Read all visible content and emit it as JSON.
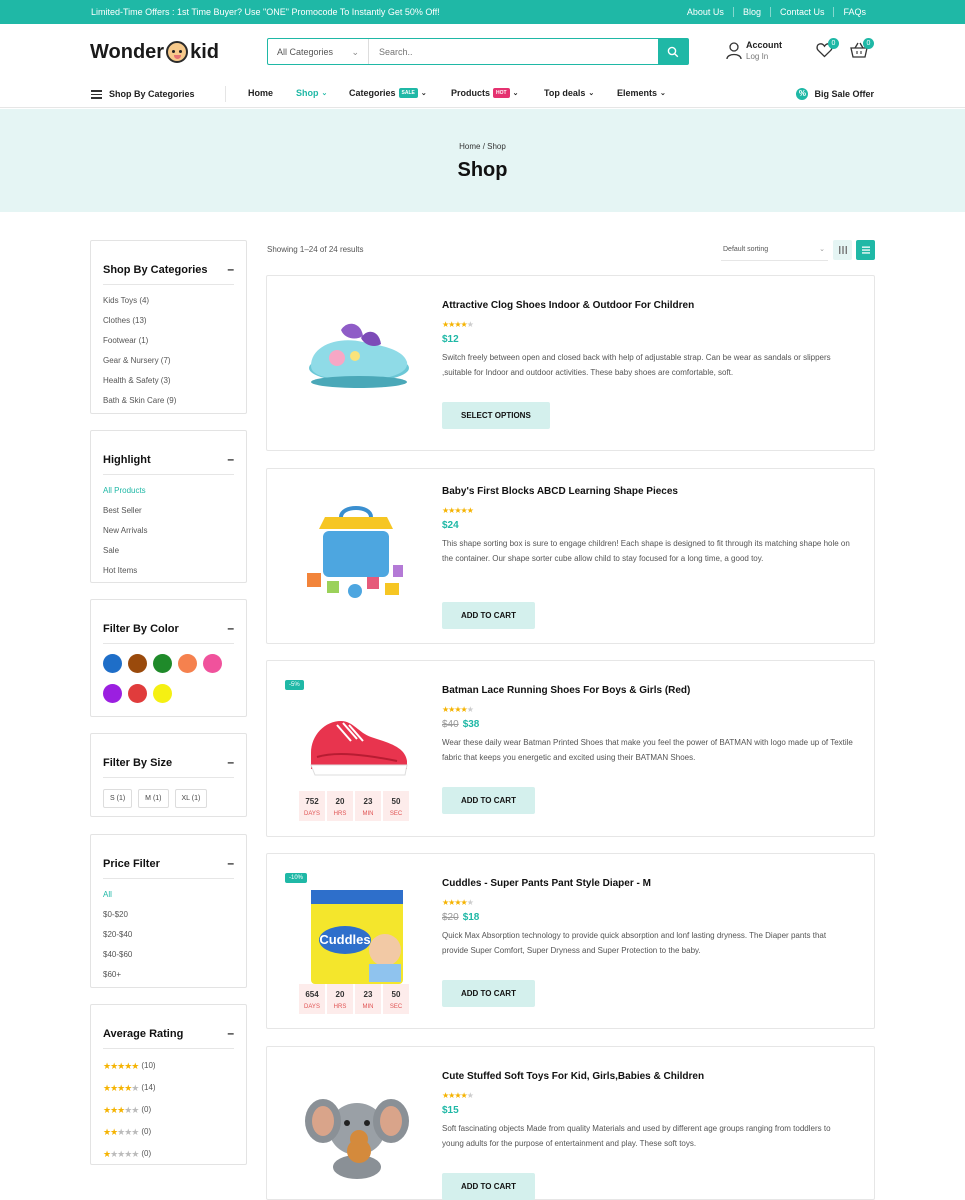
{
  "topbar": {
    "promo": "Limited-Time Offers : 1st Time Buyer? Use \"ONE\" Promocode To Instantly Get 50% Off!",
    "links": [
      "About Us",
      "Blog",
      "Contact Us",
      "FAQs"
    ]
  },
  "header": {
    "logo_left": "Wonder",
    "logo_right": "kid",
    "search_category": "All Categories",
    "search_placeholder": "Search..",
    "account_title": "Account",
    "account_sub": "Log In",
    "wishlist_count": "0",
    "cart_count": "0"
  },
  "nav": {
    "shop_by": "Shop By Categories",
    "items": [
      "Home",
      "Shop",
      "Categories",
      "Products",
      "Top deals",
      "Elements"
    ],
    "categories_tag": "SALE",
    "products_tag": "HOT",
    "big_sale": "Big Sale Offer",
    "colors": {
      "accent": "#1fb8a6",
      "sale_tag": "#1fb8a6",
      "hot_tag": "#e53270"
    }
  },
  "banner": {
    "breadcrumb": "Home / Shop",
    "title": "Shop"
  },
  "sidebar": {
    "categories": {
      "title": "Shop By Categories",
      "items": [
        "Kids Toys (4)",
        "Clothes (13)",
        "Footwear (1)",
        "Gear & Nursery (7)",
        "Health & Safety (3)",
        "Bath & Skin Care (9)"
      ]
    },
    "highlight": {
      "title": "Highlight",
      "items": [
        "All Products",
        "Best Seller",
        "New Arrivals",
        "Sale",
        "Hot Items"
      ]
    },
    "color": {
      "title": "Filter By Color",
      "swatches": [
        "#1e6ec8",
        "#9a4a0c",
        "#1f8a2a",
        "#f5814e",
        "#f0529c",
        "#9b1fe0",
        "#e03c3c",
        "#f5f012"
      ]
    },
    "size": {
      "title": "Filter By Size",
      "items": [
        "S (1)",
        "M (1)",
        "XL (1)"
      ]
    },
    "price": {
      "title": "Price Filter",
      "items": [
        "All",
        "$0-$20",
        "$20-$40",
        "$40-$60",
        "$60+"
      ]
    },
    "rating": {
      "title": "Average Rating",
      "items": [
        {
          "stars": 5,
          "count": "(10)"
        },
        {
          "stars": 4,
          "count": "(14)"
        },
        {
          "stars": 3,
          "count": "(0)"
        },
        {
          "stars": 2,
          "count": "(0)"
        },
        {
          "stars": 1,
          "count": "(0)"
        }
      ]
    }
  },
  "toolbar": {
    "results": "Showing 1–24 of 24 results",
    "sort": "Default sorting"
  },
  "products": [
    {
      "name": "Attractive Clog Shoes Indoor & Outdoor For Children",
      "rating": 4,
      "old_price": "",
      "price": "$12",
      "desc": "Switch freely between open and closed back with help of adjustable strap. Can be wear as sandals or slippers ,suitable for Indoor and outdoor activities. These baby shoes are comfortable, soft.",
      "button": "SELECT OPTIONS",
      "discount": "",
      "image": "clog-shoes"
    },
    {
      "name": "Baby's First Blocks ABCD Learning Shape Pieces",
      "rating": 5,
      "old_price": "",
      "price": "$24",
      "desc": "This shape sorting box is sure to engage children! Each shape is designed to fit through its matching shape hole on the container. Our shape sorter cube allow child to stay focused for a long time, a good toy.",
      "button": "ADD TO CART",
      "discount": "",
      "image": "shape-sorter"
    },
    {
      "name": "Batman Lace Running Shoes For Boys & Girls (Red)",
      "rating": 4,
      "old_price": "$40",
      "price": "$38",
      "desc": "Wear these daily wear Batman Printed Shoes that make you feel the power of BATMAN with logo made up of Textile fabric that keeps you energetic and excited using their BATMAN Shoes.",
      "button": "ADD TO CART",
      "discount": "-5%",
      "image": "red-sneaker",
      "countdown": [
        {
          "n": "752",
          "l": "DAYS"
        },
        {
          "n": "20",
          "l": "HRS"
        },
        {
          "n": "23",
          "l": "MIN"
        },
        {
          "n": "50",
          "l": "SEC"
        }
      ]
    },
    {
      "name": "Cuddles - Super Pants Pant Style Diaper - M",
      "rating": 4,
      "old_price": "$20",
      "price": "$18",
      "desc": "Quick Max Absorption technology to provide quick absorption and lonf lasting dryness. The Diaper pants that provide Super Comfort, Super Dryness and Super Protection to the baby.",
      "button": "ADD TO CART",
      "discount": "-10%",
      "image": "diaper-pack",
      "countdown": [
        {
          "n": "654",
          "l": "DAYS"
        },
        {
          "n": "20",
          "l": "HRS"
        },
        {
          "n": "23",
          "l": "MIN"
        },
        {
          "n": "50",
          "l": "SEC"
        }
      ]
    },
    {
      "name": "Cute Stuffed Soft Toys For Kid, Girls,Babies & Children",
      "rating": 4,
      "old_price": "",
      "price": "$15",
      "desc": "Soft fascinating objects Made from quality Materials and used by different age groups ranging from toddlers to young adults for the purpose of entertainment and play. These soft toys.",
      "button": "ADD TO CART",
      "discount": "",
      "image": "elephant-toy"
    }
  ]
}
